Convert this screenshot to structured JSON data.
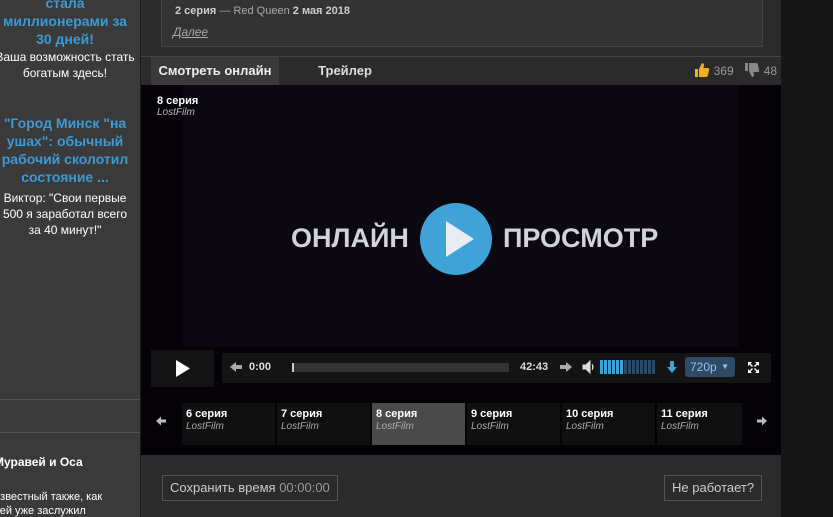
{
  "sidebar": {
    "ad1": {
      "title": "стала\nмиллионерами за\n30 дней!",
      "text": "Ваша возможность стать\nбогатым здесь!"
    },
    "ad2": {
      "title": "\"Город Минск \"на\nушах\": обычный\nрабочий сколотил\nсостояние ...",
      "text": "Виктор: \"Свои первые\n500 я заработал всего\nза 40 минут!\""
    },
    "heading": "Муравей и Оса",
    "text": "известный также, как\nчей уже заслужил"
  },
  "comment": {
    "episode": "2 серия",
    "separator": " — ",
    "author": "Red Queen",
    "date": "2 мая 2018",
    "more_label": "Далее"
  },
  "tabs": [
    {
      "label": "Смотреть онлайн",
      "active": true
    },
    {
      "label": "Трейлер",
      "active": false
    }
  ],
  "votes": {
    "likes": "369",
    "dislikes": "48"
  },
  "player": {
    "episode_title": "8 серия",
    "studio": "LostFilm",
    "online_left": "ОНЛАЙН",
    "online_right": "ПРОСМОТР",
    "time_current": "0:00",
    "time_total": "42:43",
    "progress": 0,
    "volume_bars_filled": 6,
    "volume_bars_total": 14,
    "quality": "720p",
    "colors": {
      "accent": "#3fa3d7",
      "background": "#050308"
    }
  },
  "episodes": [
    {
      "title": "6 серия",
      "studio": "LostFilm",
      "active": false
    },
    {
      "title": "7 серия",
      "studio": "LostFilm",
      "active": false
    },
    {
      "title": "8 серия",
      "studio": "LostFilm",
      "active": true
    },
    {
      "title": "9 серия",
      "studio": "LostFilm",
      "active": false
    },
    {
      "title": "10 серия",
      "studio": "LostFilm",
      "active": false
    },
    {
      "title": "11 серия",
      "studio": "LostFilm",
      "active": false
    }
  ],
  "bottom": {
    "save_label": "Сохранить время",
    "save_time": "00:00:00",
    "broken_label": "Не работает?"
  }
}
